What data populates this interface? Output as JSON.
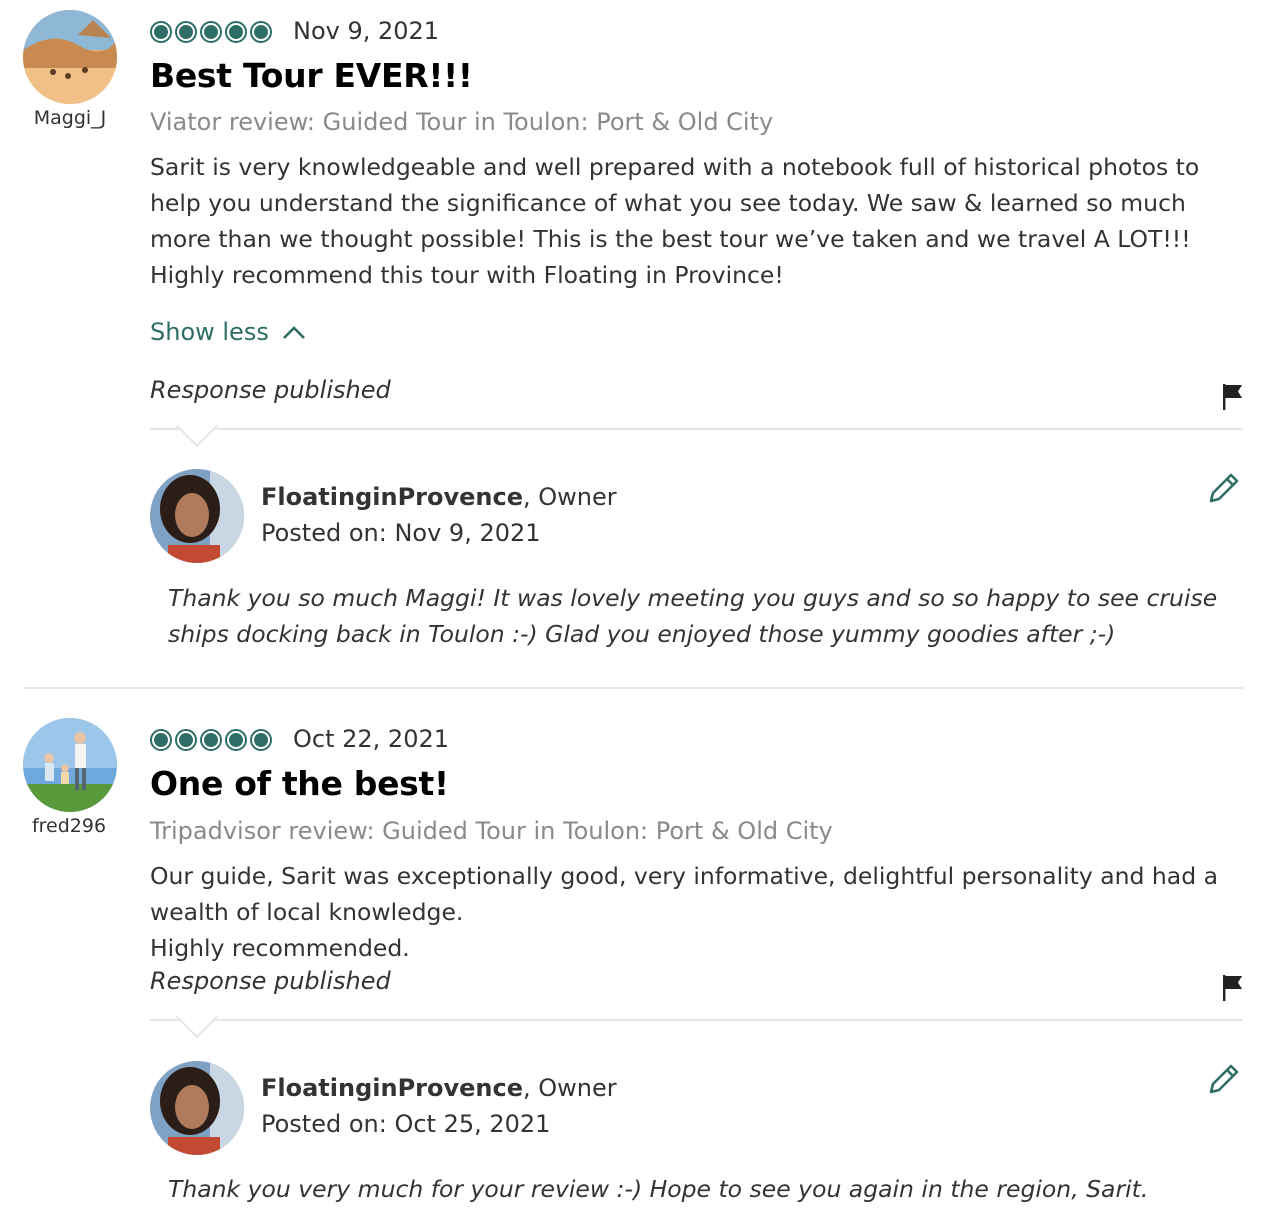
{
  "colors": {
    "accent": "#2f6e67",
    "muted": "#8a8a8a",
    "divider": "#e6e6e6"
  },
  "reviews": [
    {
      "username": "Maggi_J",
      "avatar_icon": "desert-camels-avatar",
      "rating": 5,
      "rating_max": 5,
      "date": "Nov 9, 2021",
      "title": "Best Tour EVER!!!",
      "source": "Viator review: Guided Tour in Toulon: Port & Old City",
      "body": [
        "Sarit is very knowledgeable and well prepared with a notebook full of historical photos to help you understand the significance of what you see today. We saw & learned so much more than we thought possible! This is the best tour we’ve taken and we travel A LOT!!! Highly recommend this tour with Floating in Province!"
      ],
      "show_less": "Show less",
      "response_status": "Response published",
      "response": {
        "owner_name": "FloatinginProvence",
        "owner_role": ", Owner",
        "posted_label": "Posted on: Nov 9, 2021",
        "text": "Thank you so much Maggi! It was lovely meeting you guys and so so happy to see cruise ships docking back in Toulon :-) Glad you enjoyed those yummy goodies after ;-)"
      }
    },
    {
      "username": "fred296",
      "avatar_icon": "family-walking-avatar",
      "rating": 5,
      "rating_max": 5,
      "date": "Oct 22, 2021",
      "title": "One of the best!",
      "source": "Tripadvisor review: Guided Tour in Toulon: Port & Old City",
      "body": [
        "Our guide, Sarit was exceptionally good, very informative, delightful personality and had a wealth of local knowledge.",
        "Highly recommended."
      ],
      "response_status": "Response published",
      "response": {
        "owner_name": "FloatinginProvence",
        "owner_role": ", Owner",
        "posted_label": "Posted on: Oct 25, 2021",
        "text": "Thank you very much for your review :-) Hope to see you again in the region, Sarit."
      }
    }
  ]
}
